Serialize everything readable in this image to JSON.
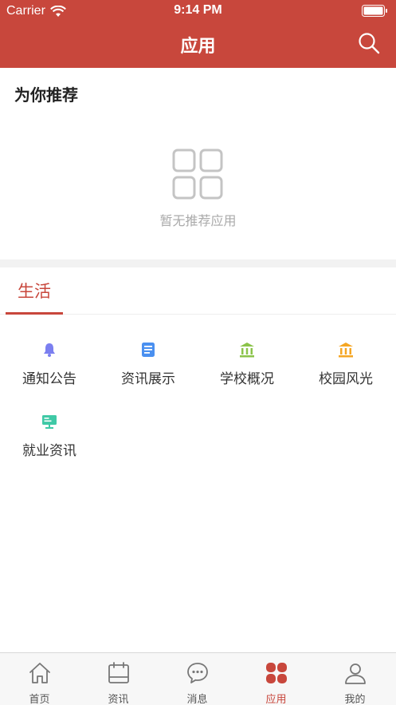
{
  "status_bar": {
    "carrier": "Carrier",
    "time": "9:14 PM"
  },
  "header": {
    "title": "应用"
  },
  "recommend": {
    "title": "为你推荐",
    "empty_text": "暂无推荐应用"
  },
  "category_tabs": [
    {
      "label": "生活",
      "active": true
    }
  ],
  "apps": [
    {
      "label": "通知公告",
      "icon": "bell-icon",
      "color": "#7b7ff0"
    },
    {
      "label": "资讯展示",
      "icon": "document-icon",
      "color": "#4a90f0"
    },
    {
      "label": "学校概况",
      "icon": "school-building-icon",
      "color": "#8bc34a"
    },
    {
      "label": "校园风光",
      "icon": "campus-building-icon",
      "color": "#f5a623"
    },
    {
      "label": "就业资讯",
      "icon": "monitor-icon",
      "color": "#3fc9a6"
    }
  ],
  "tab_bar": [
    {
      "label": "首页",
      "icon": "home-icon"
    },
    {
      "label": "资讯",
      "icon": "calendar-icon"
    },
    {
      "label": "消息",
      "icon": "chat-icon"
    },
    {
      "label": "应用",
      "icon": "apps-icon",
      "active": true
    },
    {
      "label": "我的",
      "icon": "user-icon"
    }
  ],
  "colors": {
    "primary": "#c8473c",
    "divider": "#f2f2f2",
    "muted_text": "#aaaaaa"
  }
}
